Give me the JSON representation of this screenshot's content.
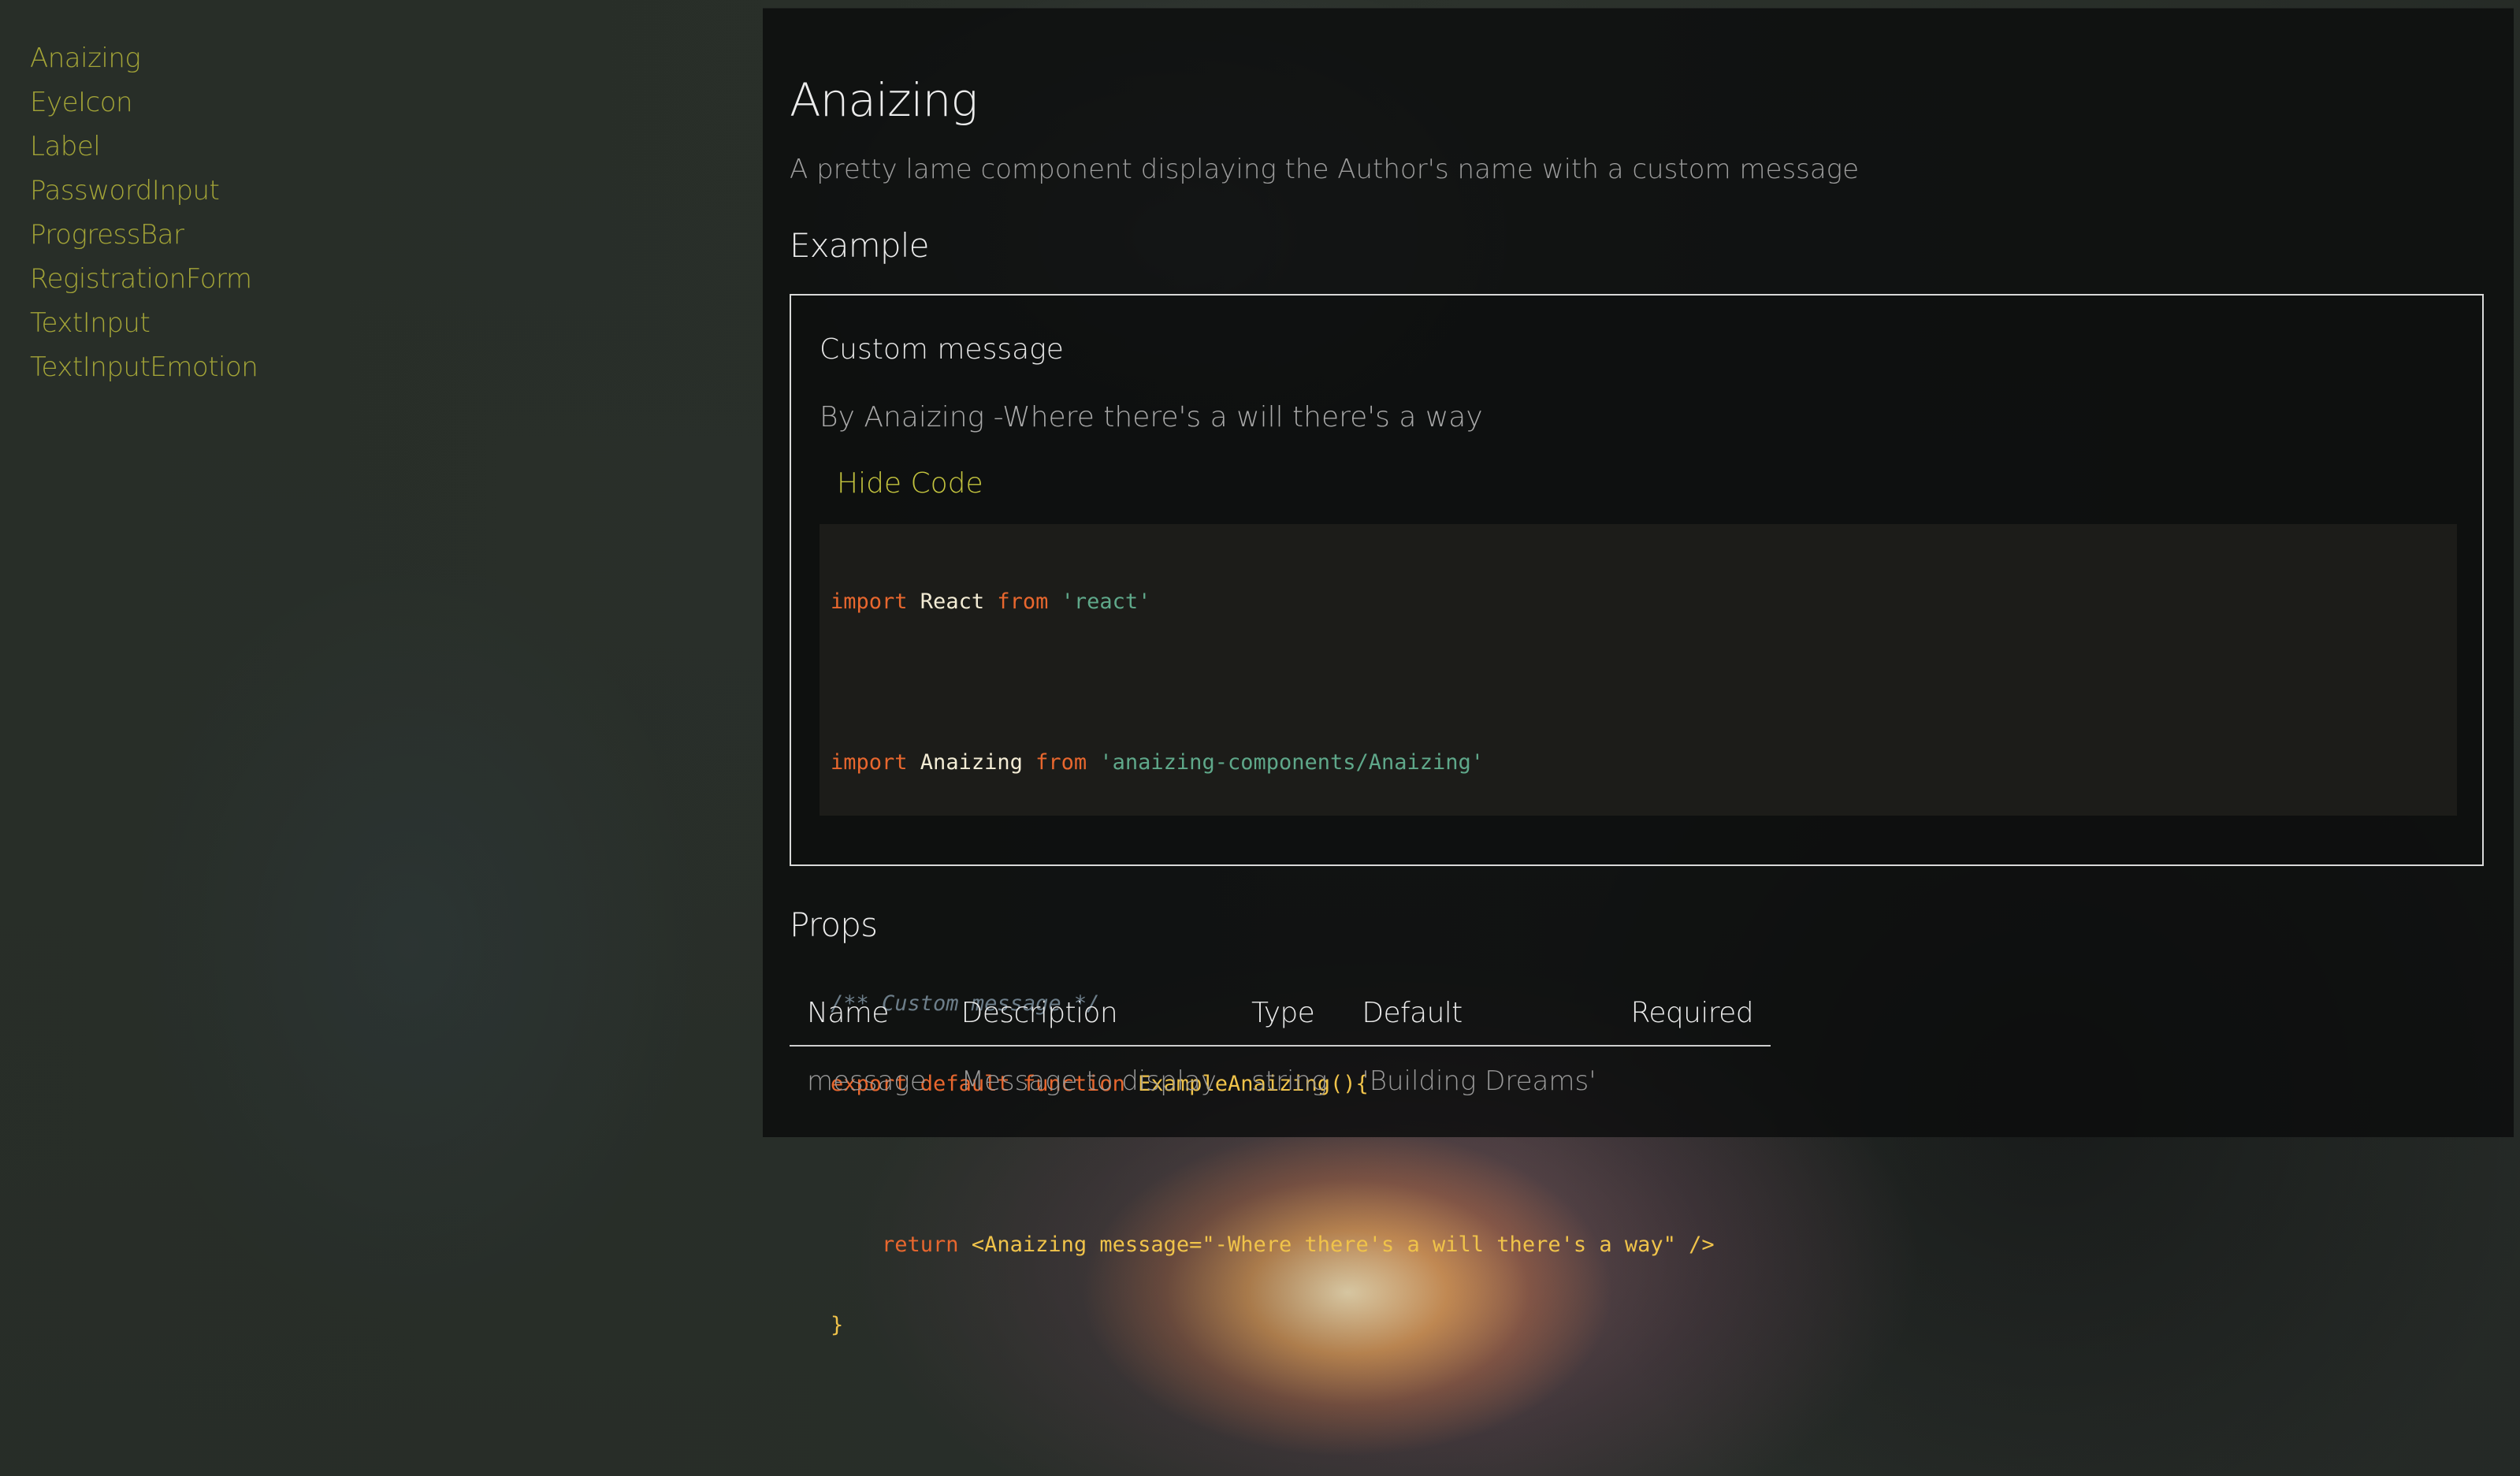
{
  "sidebar": {
    "items": [
      {
        "label": "Anaizing"
      },
      {
        "label": "EyeIcon"
      },
      {
        "label": "Label"
      },
      {
        "label": "PasswordInput"
      },
      {
        "label": "ProgressBar"
      },
      {
        "label": "RegistrationForm"
      },
      {
        "label": "TextInput"
      },
      {
        "label": "TextInputEmotion"
      }
    ]
  },
  "main": {
    "title": "Anaizing",
    "description": "A pretty lame component displaying the Author's name with a custom message",
    "example_heading": "Example",
    "example": {
      "title": "Custom message",
      "output": "By Anaizing -Where there's a will there's a way",
      "toggle_label": "Hide Code",
      "code": {
        "line1": {
          "kw1": "import",
          "id": " React ",
          "kw2": "from",
          "str": " 'react'"
        },
        "line2": {
          "kw1": "import",
          "id": " Anaizing ",
          "kw2": "from",
          "str": " 'anaizing-components/Anaizing'"
        },
        "line3_comment": "/** Custom message */",
        "line4": {
          "kw1": "export",
          "kw2": " default",
          "kw3": " function",
          "fn": " ExampleAnaizing(){"
        },
        "line5": {
          "indent": "    ",
          "kw": "return",
          "tag": " <Anaizing message=\"-Where there's a will there's a way\" />"
        },
        "line6": "}"
      }
    },
    "props_heading": "Props",
    "props_table": {
      "headers": [
        "Name",
        "Description",
        "Type",
        "Default",
        "Required"
      ],
      "rows": [
        [
          "message",
          "Message to display",
          "string",
          "'Building Dreams'",
          ""
        ]
      ]
    }
  },
  "colors": {
    "accent": "#b9b93a",
    "panel_bg": "#0c0d0d",
    "code_keyword": "#e8672e",
    "code_string": "#5fa88a",
    "code_function": "#f0c34a",
    "code_comment": "#6d7e8a"
  }
}
